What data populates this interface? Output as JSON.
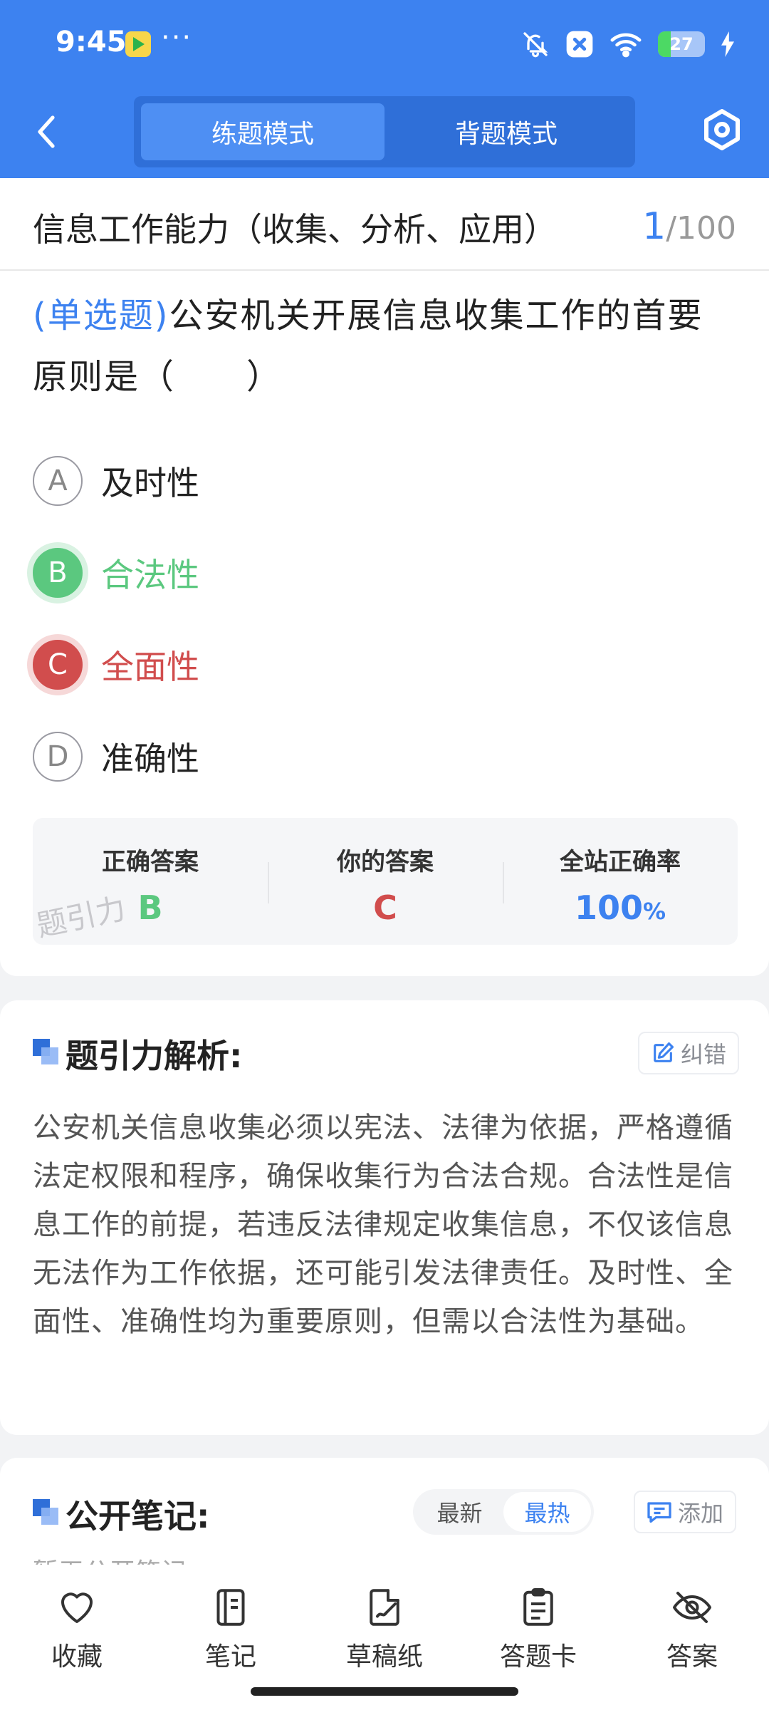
{
  "status_bar": {
    "time": "9:45",
    "more": "···",
    "battery": "27",
    "battery_level": 0.27
  },
  "header": {
    "tabs": [
      {
        "label": "练题模式",
        "active": true
      },
      {
        "label": "背题模式",
        "active": false
      }
    ]
  },
  "question": {
    "section_title": "信息工作能力（收集、分析、应用）",
    "current": "1",
    "total": "/100",
    "type_label": "(单选题)",
    "text": "公安机关开展信息收集工作的首要原则是（　　）",
    "options": [
      {
        "letter": "A",
        "text": "及时性",
        "state": "normal"
      },
      {
        "letter": "B",
        "text": "合法性",
        "state": "correct"
      },
      {
        "letter": "C",
        "text": "全面性",
        "state": "wrong"
      },
      {
        "letter": "D",
        "text": "准确性",
        "state": "normal"
      }
    ]
  },
  "answer_summary": {
    "correct_label": "正确答案",
    "correct_value": "B",
    "yours_label": "你的答案",
    "yours_value": "C",
    "rate_label": "全站正确率",
    "rate_value": "100",
    "rate_unit": "%",
    "watermark": "题引力"
  },
  "analysis": {
    "title": "题引力解析:",
    "report_label": "纠错",
    "text": "公安机关信息收集必须以宪法、法律为依据，严格遵循法定权限和程序，确保收集行为合法合规。合法性是信息工作的前提，若违反法律规定收集信息，不仅该信息无法作为工作依据，还可能引发法律责任。及时性、全面性、准确性均为重要原则，但需以合法性为基础。"
  },
  "notes": {
    "title": "公开笔记:",
    "sort_options": [
      {
        "label": "最新",
        "active": false
      },
      {
        "label": "最热",
        "active": true
      }
    ],
    "add_label": "添加",
    "empty_text": "暂无公开笔记"
  },
  "bottom_nav": [
    {
      "label": "收藏",
      "icon": "heart-icon"
    },
    {
      "label": "笔记",
      "icon": "notebook-icon"
    },
    {
      "label": "草稿纸",
      "icon": "draft-paper-icon"
    },
    {
      "label": "答题卡",
      "icon": "answer-card-icon"
    },
    {
      "label": "答案",
      "icon": "eye-off-icon"
    }
  ],
  "colors": {
    "primary": "#3d82f0",
    "correct": "#5bc87f",
    "wrong": "#d14d4d"
  }
}
